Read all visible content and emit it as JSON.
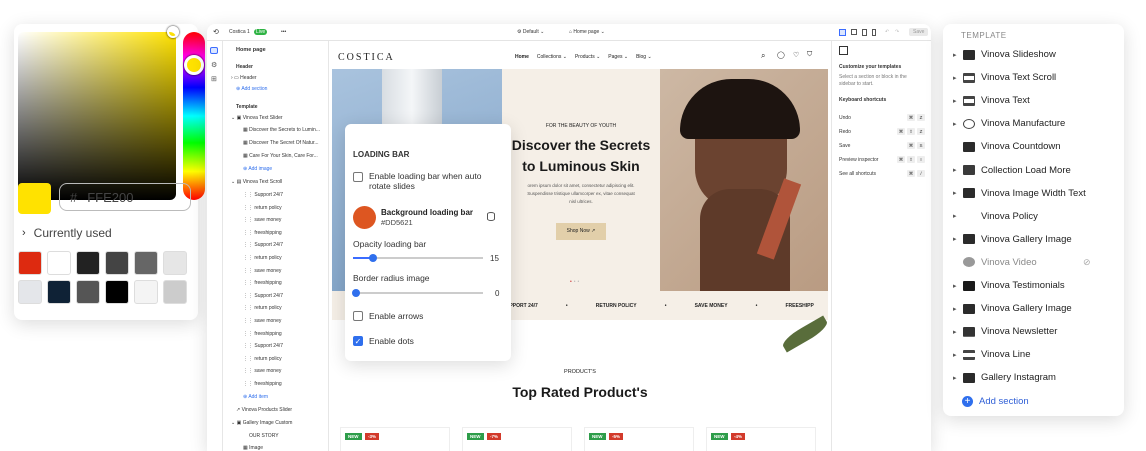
{
  "color_picker": {
    "hex_prefix": "#",
    "hex_value": "FFE200",
    "currently_used_label": "Currently used",
    "selected_color": "#FFE200",
    "swatches": [
      "#DD2A10",
      "#FFFFFF",
      "#222222",
      "#444444",
      "#666666",
      "#E6E6E6",
      "#E4E6EA",
      "#0F2236",
      "#555555",
      "#000000",
      "#F4F4F4",
      "#CCCCCC"
    ]
  },
  "topbar": {
    "store_name": "Costica 1",
    "live_badge": "Live",
    "theme_select": "Default",
    "page_select": "Home page",
    "save_button": "Save"
  },
  "tree": {
    "page_title": "Home page",
    "header_section": "Header",
    "header_item": "Header",
    "add_section": "Add section",
    "template_label": "Template",
    "text_slider": "Vinova Text Slider",
    "slides": [
      "Discover the Secrets to Lumin...",
      "Discover The Secret Of Natur...",
      "Care For Your Skin, Care For..."
    ],
    "add_image": "Add image",
    "text_scroll": "Vinova Text Scroll",
    "scroll_items": [
      "Support 24/7",
      "return policy",
      "save money",
      "freeshipping",
      "Support 24/7",
      "return policy",
      "save money",
      "freeshipping",
      "Support 24/7",
      "return policy",
      "save money",
      "freeshipping",
      "Support 24/7",
      "return policy",
      "save money",
      "freeshipping"
    ],
    "add_item": "Add item",
    "products_slider": "Vinova Products Slider",
    "gallery_custom": "Gallery Image Custom",
    "our_story": "OUR STORY",
    "image_item": "Image"
  },
  "storefront": {
    "logo": "COSTICA",
    "nav": [
      "Home",
      "Collections",
      "Products",
      "Pages",
      "Blog"
    ],
    "eyebrow": "FOR THE BEAUTY OF YOUTH",
    "headline_1": "Discover the Secrets",
    "headline_2": "to Luminous Skin",
    "body_1": "orem ipsum dolor sit amet, consectetur adipiscing elit.",
    "body_2": "Suspendisse tristique ullamcorper ex, vitae consequat",
    "body_3": "nisl ultrices.",
    "cta": "Shop Now",
    "marquee": [
      "Y",
      "FREESHIPPING",
      "SUPPORT 24/7",
      "RETURN POLICY",
      "SAVE MONEY",
      "FREESHIPP"
    ],
    "products_eyebrow": "PRODUCT'S",
    "products_title": "Top Rated Product's",
    "cards": [
      {
        "new": "NEW",
        "sale": "-3%"
      },
      {
        "new": "NEW",
        "sale": "-7%"
      },
      {
        "new": "NEW",
        "sale": "-5%"
      },
      {
        "new": "NEW",
        "sale": "-4%"
      }
    ]
  },
  "right_panel": {
    "title": "Customize your templates",
    "desc_1": "Select a section or block in the",
    "desc_2": "sidebar to start.",
    "shortcuts_title": "Keyboard shortcuts",
    "shortcuts": [
      {
        "label": "Undo",
        "keys": [
          "⌘",
          "Z"
        ]
      },
      {
        "label": "Redo",
        "keys": [
          "⌘",
          "⇧",
          "Z"
        ]
      },
      {
        "label": "Save",
        "keys": [
          "⌘",
          "S"
        ]
      },
      {
        "label": "Preview inspector",
        "keys": [
          "⌘",
          "⇧",
          "I"
        ]
      },
      {
        "label": "See all shortcuts",
        "keys": [
          "⌘",
          "/"
        ]
      }
    ]
  },
  "loading_panel": {
    "title": "LOADING BAR",
    "enable_label_1": "Enable loading bar when auto",
    "enable_label_2": "rotate slides",
    "bg_label": "Background loading bar",
    "bg_hex": "#DD5621",
    "bg_color": "#DD5621",
    "opacity_label": "Opacity loading bar",
    "opacity_value": "15",
    "opacity_level": 0.15,
    "radius_label": "Border radius image",
    "radius_value": "0",
    "radius_level": 0,
    "arrows_label": "Enable arrows",
    "dots_label": "Enable dots",
    "dots_checked": true
  },
  "template_list": {
    "header": "TEMPLATE",
    "items": [
      {
        "label": "Vinova Slideshow",
        "icon": "slideshow-icon",
        "chevron": true
      },
      {
        "label": "Vinova Text Scroll",
        "icon": "text-icon",
        "chevron": true
      },
      {
        "label": "Vinova Text",
        "icon": "text-icon",
        "chevron": true
      },
      {
        "label": "Vinova Manufacture",
        "icon": "manufacture-icon",
        "chevron": true
      },
      {
        "label": "Vinova Countdown",
        "icon": "image-icon",
        "chevron": false
      },
      {
        "label": "Collection Load More",
        "icon": "collection-icon",
        "chevron": true
      },
      {
        "label": "Vinova Image Width Text",
        "icon": "image-text-icon",
        "chevron": true
      },
      {
        "label": "Vinova Policy",
        "icon": "",
        "chevron": true
      },
      {
        "label": "Vinova Gallery Image",
        "icon": "gallery-icon",
        "chevron": true
      },
      {
        "label": "Vinova Video",
        "icon": "play-icon",
        "chevron": false
      },
      {
        "label": "Vinova Testimonials",
        "icon": "testimonials-icon",
        "chevron": true
      },
      {
        "label": "Vinova Gallery Image",
        "icon": "gallery-icon",
        "chevron": true
      },
      {
        "label": "Vinova Newsletter",
        "icon": "mail-icon",
        "chevron": true
      },
      {
        "label": "Vinova Line",
        "icon": "line-icon",
        "chevron": true
      },
      {
        "label": "Gallery Instagram",
        "icon": "gallery-icon",
        "chevron": true
      }
    ],
    "add_section": "Add section"
  }
}
